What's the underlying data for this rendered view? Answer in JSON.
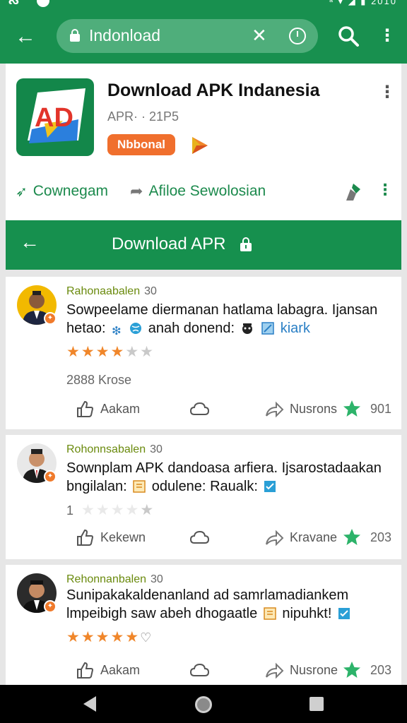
{
  "status": {
    "left": "ᔓ",
    "right": "ᵃ ▾ ◢ ▮ 2010"
  },
  "search": {
    "text": "Indonload"
  },
  "app": {
    "title": "Download APK Indanesia",
    "meta": "APR· · 21P5",
    "badge": "Nbbonal",
    "logo_text": "AD",
    "share_label": "Cownegam",
    "forward_label": "Afiloe Sewolosian"
  },
  "download_banner": {
    "title": "Download APR"
  },
  "reviews": [
    {
      "name": "Rahonaabalen",
      "num": "30",
      "line1": "Sowpeelame diermanan hatlama labagra. Ijansan",
      "line2_a": "hetao:",
      "line2_b": "anah donend:",
      "line2_c": "kiark",
      "rating": 4,
      "sub": "2888 Krose",
      "like_label": "Aakam",
      "share_label": "Nusrons",
      "count": "901"
    },
    {
      "name": "Rohonnsabalen",
      "num": "30",
      "line1": "Sownplam APK dandoasa arfiera. Ijsarostadaakan",
      "line2_a": "bngilalan:",
      "line2_b": "odulene:",
      "line2_c": "Raualk:",
      "rating": 0,
      "sub": "1",
      "like_label": "Kekewn",
      "share_label": "Kravane",
      "count": "203"
    },
    {
      "name": "Rehonnanbalen",
      "num": "30",
      "line1": "Sunipakakaldenanland ad samrlamadiankem",
      "line2_a": "lmpeibigh saw abeh dhogaatle",
      "line2_b": "nipuhkt!",
      "rating": 5,
      "like_label": "Aakam",
      "share_label": "Nusrone",
      "count": "203"
    }
  ],
  "colors": {
    "primary": "#18904f",
    "accent": "#f06f2d",
    "star": "#f0862a"
  }
}
